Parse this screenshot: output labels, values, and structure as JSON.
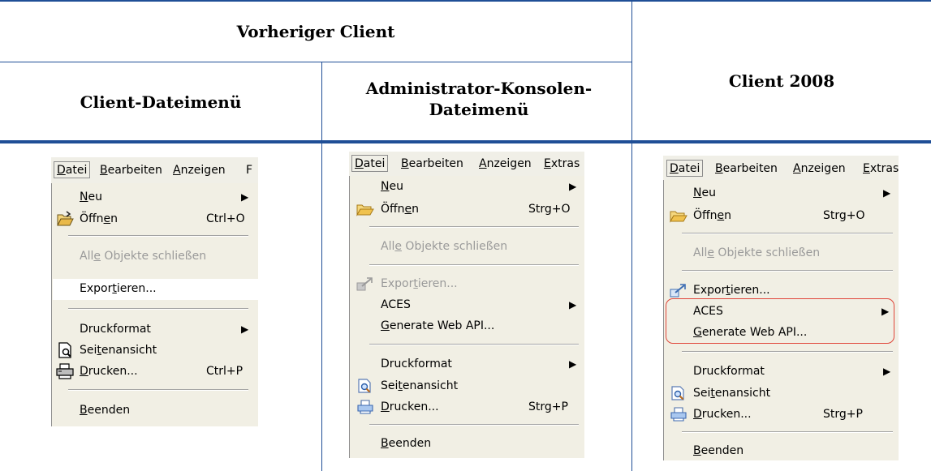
{
  "table": {
    "previous_client": "Vorheriger Client",
    "client_menu": "Client-Dateimenü",
    "admin_menu": "Administrator-Konsolen-Dateimenü",
    "client2008": "Client 2008"
  },
  "menubar1": [
    "Datei",
    "Bearbeiten",
    "Anzeigen",
    "F"
  ],
  "menubar2": [
    "Datei",
    "Bearbeiten",
    "Anzeigen",
    "Extras"
  ],
  "menubar3": [
    "Datei",
    "Bearbeiten",
    "Anzeigen",
    "Extras"
  ],
  "menu1": {
    "neu": "Neu",
    "oeffnen": "Öffnen",
    "oeffnen_sc": "Ctrl+O",
    "alle": "Alle Objekte schließen",
    "export": "Exportieren...",
    "druckformat": "Druckformat",
    "seitenansicht": "Seitenansicht",
    "drucken": "Drucken...",
    "drucken_sc": "Ctrl+P",
    "beenden": "Beenden"
  },
  "menu2": {
    "neu": "Neu",
    "oeffnen": "Öffnen",
    "oeffnen_sc": "Strg+O",
    "alle": "Alle Objekte schließen",
    "export": "Exportieren...",
    "aces": "ACES",
    "webapi": "Generate Web API...",
    "druckformat": "Druckformat",
    "seitenansicht": "Seitenansicht",
    "drucken": "Drucken...",
    "drucken_sc": "Strg+P",
    "beenden": "Beenden"
  },
  "menu3": {
    "neu": "Neu",
    "oeffnen": "Öffnen",
    "oeffnen_sc": "Strg+O",
    "alle": "Alle Objekte schließen",
    "export": "Exportieren...",
    "aces": "ACES",
    "webapi": "Generate Web API...",
    "druckformat": "Druckformat",
    "seitenansicht": "Seitenansicht",
    "drucken": "Drucken...",
    "drucken_sc": "Strg+P",
    "beenden": "Beenden"
  },
  "colors": {
    "rule": "#1f4e96",
    "highlight_box": "#e0463a"
  }
}
